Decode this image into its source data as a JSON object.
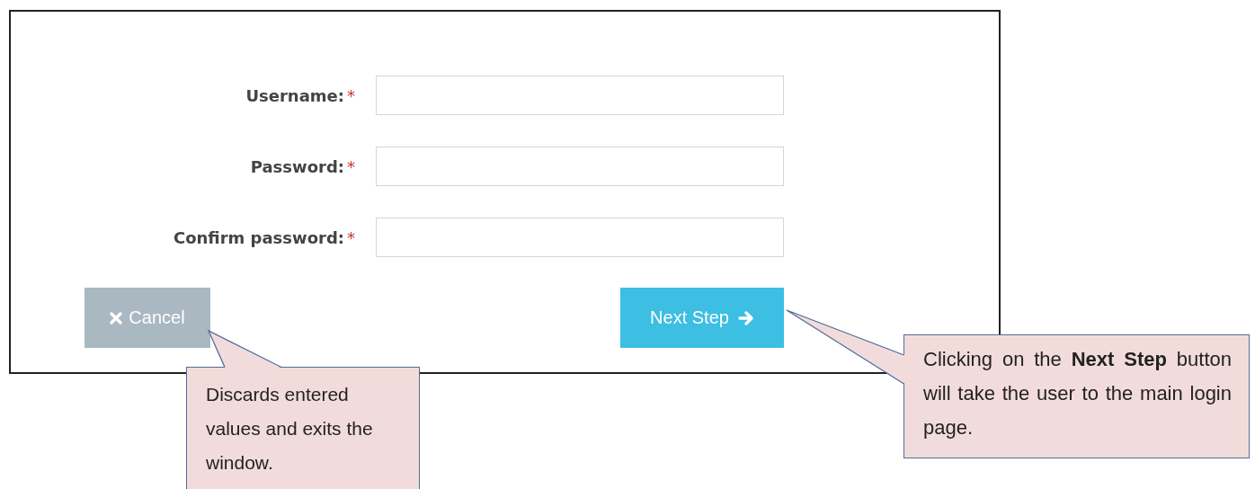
{
  "form": {
    "fields": [
      {
        "label": "Username:",
        "required_mark": "*"
      },
      {
        "label": "Password:",
        "required_mark": "*"
      },
      {
        "label": "Confirm password:",
        "required_mark": "*"
      }
    ],
    "buttons": [
      {
        "label": "Cancel",
        "kind": "cancel"
      },
      {
        "label": "Next Step",
        "kind": "next"
      }
    ]
  },
  "callouts": [
    {
      "text": "Discards entered values and exits the window.",
      "kind": "left"
    },
    {
      "text": "Clicking on the **Next Step** button will take the user to the main login page.",
      "kind": "right"
    }
  ]
}
